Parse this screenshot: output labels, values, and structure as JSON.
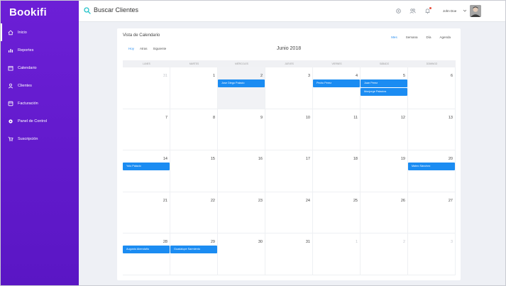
{
  "app": {
    "logo": "Bookifi"
  },
  "sidebar": {
    "items": [
      {
        "label": "Inicio",
        "icon": "home-icon",
        "active": true
      },
      {
        "label": "Reportes",
        "icon": "bar-chart-icon",
        "active": false
      },
      {
        "label": "Calendario",
        "icon": "calendar-icon",
        "active": false
      },
      {
        "label": "Clientes",
        "icon": "user-icon",
        "active": false
      },
      {
        "label": "Facturación",
        "icon": "invoice-icon",
        "active": false
      },
      {
        "label": "Panel de Control",
        "icon": "gear-icon",
        "active": false
      },
      {
        "label": "Suscripción",
        "icon": "cart-icon",
        "active": false
      }
    ]
  },
  "header": {
    "search_label": "Buscar Clientes",
    "user_name": "John Doe",
    "icons": [
      "settings-icon",
      "users-icon",
      "bell-icon"
    ]
  },
  "calendar": {
    "title": "Vista de Calendario",
    "month": "Junio 2018",
    "nav": [
      {
        "label": "Hoy",
        "active": true
      },
      {
        "label": "Atras",
        "active": false
      },
      {
        "label": "Siguiente",
        "active": false
      }
    ],
    "views": [
      {
        "label": "Mes",
        "active": true
      },
      {
        "label": "Semana",
        "active": false
      },
      {
        "label": "Día",
        "active": false
      },
      {
        "label": "Agenda",
        "active": false
      }
    ],
    "days_of_week": [
      "Lunes",
      "Martes",
      "Miércoles",
      "Jueves",
      "Viernes",
      "Sábado",
      "Domingo"
    ],
    "weeks": [
      [
        {
          "n": "31",
          "other": true
        },
        {
          "n": "1"
        },
        {
          "n": "2",
          "today": true
        },
        {
          "n": "3"
        },
        {
          "n": "4"
        },
        {
          "n": "5"
        },
        {
          "n": "6"
        }
      ],
      [
        {
          "n": "7"
        },
        {
          "n": "8"
        },
        {
          "n": "9"
        },
        {
          "n": "10"
        },
        {
          "n": "11"
        },
        {
          "n": "12"
        },
        {
          "n": "13"
        }
      ],
      [
        {
          "n": "14"
        },
        {
          "n": "15"
        },
        {
          "n": "16"
        },
        {
          "n": "17"
        },
        {
          "n": "18"
        },
        {
          "n": "19"
        },
        {
          "n": "20"
        }
      ],
      [
        {
          "n": "21"
        },
        {
          "n": "22"
        },
        {
          "n": "23"
        },
        {
          "n": "24"
        },
        {
          "n": "25"
        },
        {
          "n": "26"
        },
        {
          "n": "27"
        }
      ],
      [
        {
          "n": "28"
        },
        {
          "n": "29"
        },
        {
          "n": "30"
        },
        {
          "n": "31"
        },
        {
          "n": "1",
          "other": true
        },
        {
          "n": "2",
          "other": true
        },
        {
          "n": "3",
          "other": true
        }
      ]
    ],
    "events": [
      {
        "label": "Jose Diego Palacio",
        "week": 0,
        "day": 2,
        "slot": 0
      },
      {
        "label": "Pedro Perez",
        "week": 0,
        "day": 4,
        "slot": 0
      },
      {
        "label": "Juan Perez",
        "week": 0,
        "day": 5,
        "slot": 0
      },
      {
        "label": "Monjorge Palacios",
        "week": 0,
        "day": 5,
        "slot": 1
      },
      {
        "label": "Yolo Palacio",
        "week": 2,
        "day": 0,
        "slot": 0
      },
      {
        "label": "Mateo Sánchez",
        "week": 2,
        "day": 6,
        "slot": 0
      },
      {
        "label": "Augusto Abendaño",
        "week": 4,
        "day": 0,
        "slot": 0
      },
      {
        "label": "Guadalupe Sarmiento",
        "week": 4,
        "day": 1,
        "slot": 0
      }
    ]
  },
  "colors": {
    "sidebar": "#6c1fd6",
    "accent": "#1b8cf2",
    "active_tab": "#2c8ff0"
  }
}
